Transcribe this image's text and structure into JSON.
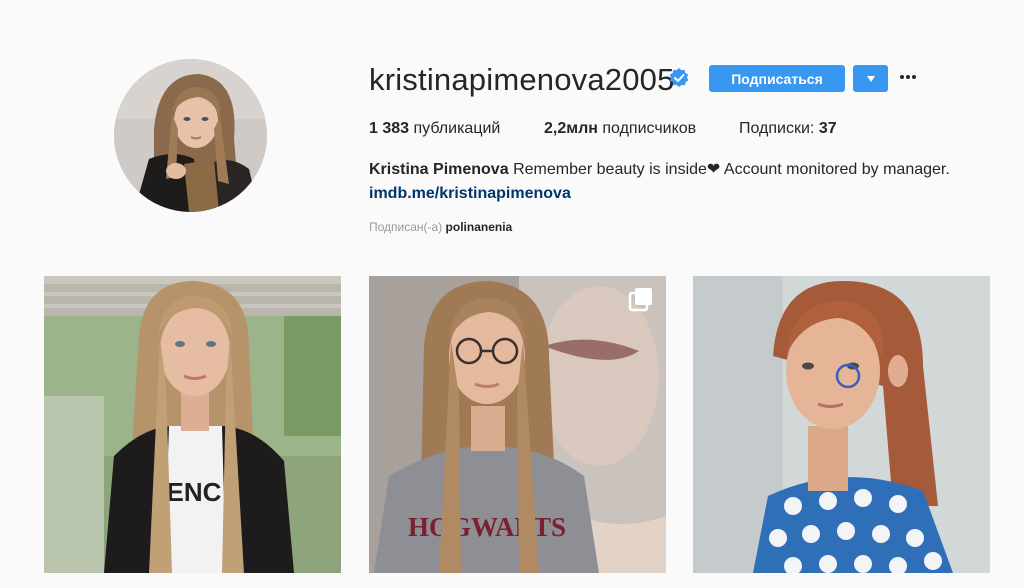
{
  "profile": {
    "username": "kristinapimenova2005",
    "verified": true,
    "follow_label": "Подписаться",
    "dropdown_icon": "caret-down-icon",
    "more_icon": "ellipsis-icon",
    "stats": {
      "posts_count": "1 383",
      "posts_label": "публикаций",
      "followers_count": "2,2млн",
      "followers_label": "подписчиков",
      "following_label": "Подписки:",
      "following_count": "37"
    },
    "bio": {
      "full_name": "Kristina Pimenova",
      "text": "Remember beauty is inside❤ Account monitored by manager.",
      "link": "imdb.me/kristinapimenova"
    },
    "followed_by": {
      "label": "Подписан(-а)",
      "user": "polinanenia"
    }
  },
  "posts": [
    {
      "id": "post-1",
      "multi": false
    },
    {
      "id": "post-2",
      "multi": true
    },
    {
      "id": "post-3",
      "multi": false
    }
  ],
  "colors": {
    "accent": "#3897f0",
    "link": "#003569",
    "verified": "#3897f0",
    "background": "#fafafa"
  }
}
